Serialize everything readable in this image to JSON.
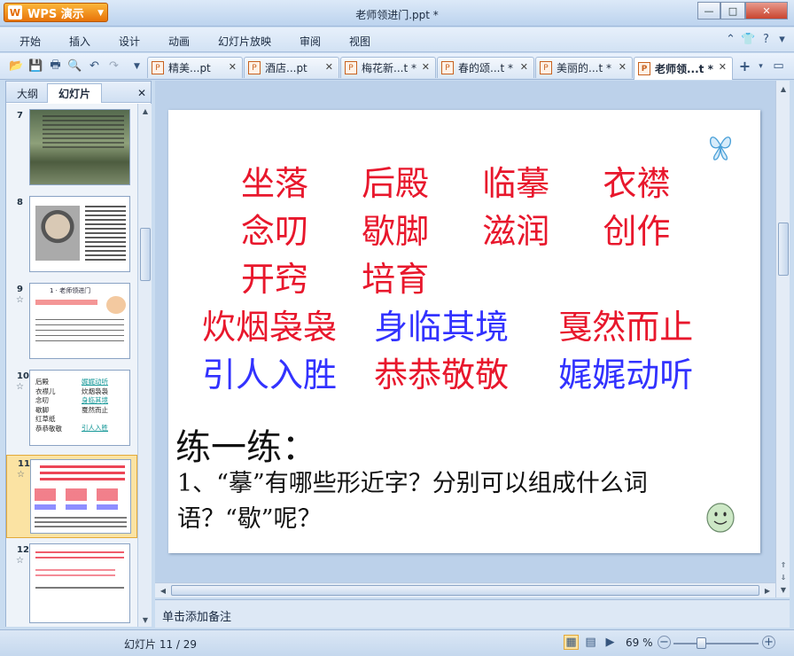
{
  "app": {
    "brand": "WPS 演示",
    "logo_letter": "W",
    "document_title": "老师领进门.ppt *"
  },
  "window_controls": {
    "minimize": "—",
    "maximize": "□",
    "close": "✕"
  },
  "menu": {
    "items": [
      "开始",
      "插入",
      "设计",
      "动画",
      "幻灯片放映",
      "审阅",
      "视图"
    ]
  },
  "tabs": [
    {
      "label": "精美...pt",
      "modified": false
    },
    {
      "label": "酒店...pt",
      "modified": false
    },
    {
      "label": "梅花新...t *",
      "modified": true
    },
    {
      "label": "春的颂...t *",
      "modified": true
    },
    {
      "label": "美丽的...t *",
      "modified": true
    },
    {
      "label": "老师领...t *",
      "modified": true,
      "active": true
    }
  ],
  "tab_close_glyph": "✕",
  "left_panel": {
    "tab_outline": "大纲",
    "tab_slides": "幻灯片",
    "close_glyph": "✕"
  },
  "thumbnails": [
    {
      "number": "7",
      "kind": "photo-text"
    },
    {
      "number": "8",
      "kind": "portrait"
    },
    {
      "number": "9",
      "title": "1 · 老师领进门"
    },
    {
      "number": "10",
      "left_col": [
        "后殿",
        "衣襟儿",
        "念叨",
        "歇脚",
        "红草纸",
        "恭恭敬敬"
      ],
      "right_col": [
        "娓娓动听",
        "炊烟袅袅",
        "身临其境",
        "戛然而止",
        "引人入胜"
      ]
    },
    {
      "number": "11",
      "selected": true
    },
    {
      "number": "12"
    }
  ],
  "slide": {
    "row1": [
      "坐落",
      "后殿",
      "临摹",
      "衣襟"
    ],
    "row2": [
      "念叨",
      "歇脚",
      "滋润",
      "创作"
    ],
    "row3": [
      "开窍",
      "培育"
    ],
    "row4": [
      "炊烟袅袅",
      "身临其境",
      "戛然而止"
    ],
    "row5": [
      "引人入胜",
      "恭恭敬敬",
      "娓娓动听"
    ],
    "practice_title": "练一练：",
    "practice_question": "1、“摹”有哪些形近字？分别可以组成什么词语？“歇”呢？"
  },
  "notes": {
    "placeholder": "单击添加备注"
  },
  "status": {
    "slide_counter": "幻灯片 11 / 29",
    "zoom": "69 %"
  },
  "colors": {
    "red": "#e8172c",
    "blue": "#3232ff",
    "accent": "#f08a1c"
  },
  "icons": [
    "open-icon",
    "save-icon",
    "print-icon",
    "preview-icon",
    "undo-icon",
    "redo-icon",
    "butterfly-icon",
    "smiley-icon"
  ]
}
